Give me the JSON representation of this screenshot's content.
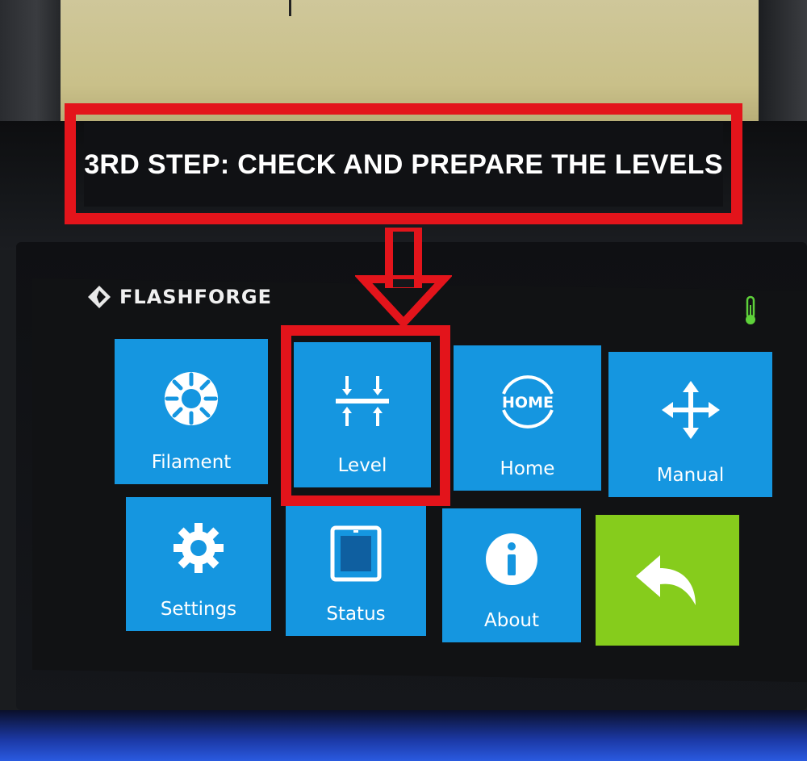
{
  "annotation": {
    "banner_text": "3RD STEP: CHECK AND PREPARE THE LEVELS",
    "highlight_color": "#e3141b"
  },
  "header": {
    "brand": "FLASHFORGE",
    "status_icon": "thermometer-icon"
  },
  "tiles": [
    {
      "label": "Filament",
      "icon": "filament-spool-icon",
      "color": "#1596e0"
    },
    {
      "label": "Level",
      "icon": "level-arrows-icon",
      "color": "#1596e0",
      "highlighted": true
    },
    {
      "label": "Home",
      "icon": "home-badge-icon",
      "icon_text": "HOME",
      "color": "#1596e0"
    },
    {
      "label": "Manual",
      "icon": "move-arrows-icon",
      "color": "#1596e0"
    },
    {
      "label": "Settings",
      "icon": "gear-icon",
      "color": "#1596e0"
    },
    {
      "label": "Status",
      "icon": "printer-window-icon",
      "color": "#1596e0"
    },
    {
      "label": "About",
      "icon": "info-icon",
      "color": "#1596e0"
    },
    {
      "label": "",
      "icon": "back-arrow-icon",
      "color": "#86cc1c"
    }
  ]
}
